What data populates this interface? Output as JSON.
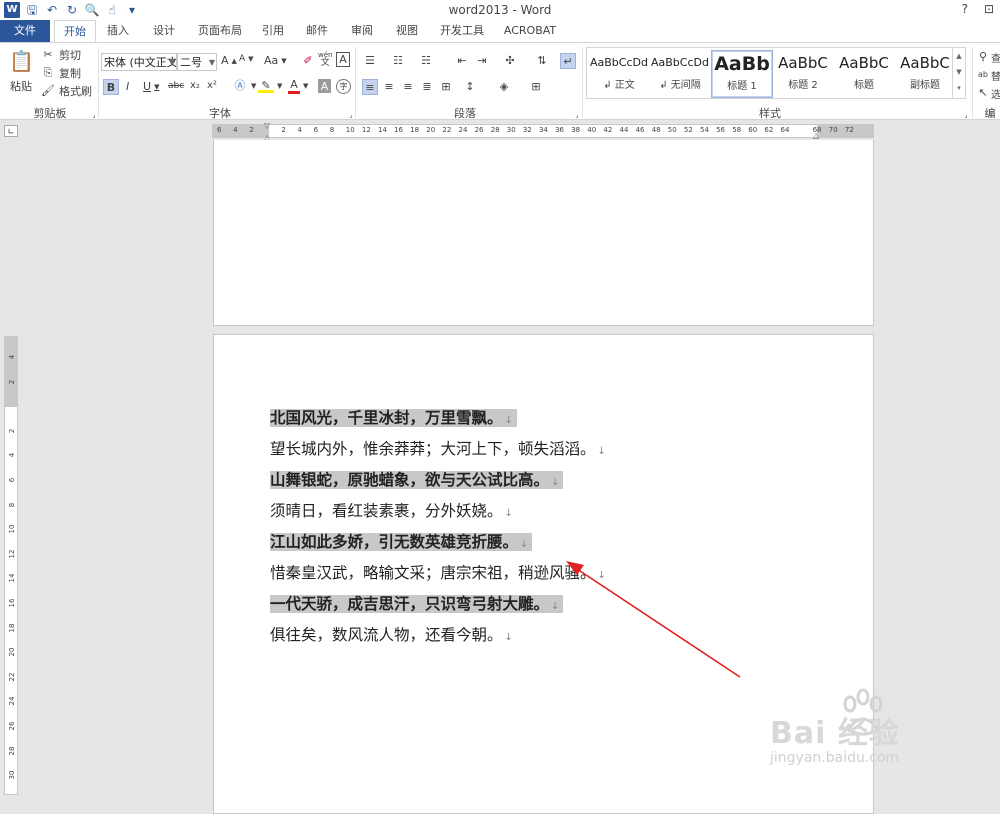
{
  "window": {
    "title": "word2013 - Word",
    "help": "?",
    "restore": "⊡"
  },
  "tabs": [
    "文件",
    "开始",
    "插入",
    "设计",
    "页面布局",
    "引用",
    "邮件",
    "审阅",
    "视图",
    "开发工具",
    "ACROBAT"
  ],
  "ribbon": {
    "clipboard": {
      "label": "剪贴板",
      "paste": "粘贴",
      "cut": "剪切",
      "copy": "复制",
      "format_painter": "格式刷"
    },
    "font": {
      "label": "字体",
      "font_name": "宋体 (中文正文",
      "font_size": "二号",
      "bold": "B",
      "italic": "I",
      "underline": "U",
      "strike": "abc",
      "sub": "x₂",
      "sup": "x²",
      "grow": "A",
      "shrink": "A",
      "case": "Aa",
      "font_color": "A",
      "char_shade": "A",
      "char_border": "A",
      "phonetic": "wén",
      "phonetic_sub": "文",
      "enclose": "字"
    },
    "paragraph": {
      "label": "段落"
    },
    "styles": {
      "label": "样式",
      "items": [
        {
          "sample": "AaBbCcDd",
          "name": "↲ 正文"
        },
        {
          "sample": "AaBbCcDd",
          "name": "↲ 无间隔"
        },
        {
          "sample": "AaBb",
          "name": "标题 1"
        },
        {
          "sample": "AaBbC",
          "name": "标题 2"
        },
        {
          "sample": "AaBbC",
          "name": "标题"
        },
        {
          "sample": "AaBbC",
          "name": "副标题"
        }
      ]
    },
    "editing": {
      "label": "编",
      "find": "查",
      "replace": "替",
      "select": "选"
    }
  },
  "ruler_h": [
    "6",
    "4",
    "2",
    "",
    "2",
    "4",
    "6",
    "8",
    "10",
    "12",
    "14",
    "16",
    "18",
    "20",
    "22",
    "24",
    "26",
    "28",
    "30",
    "32",
    "34",
    "36",
    "38",
    "40",
    "42",
    "44",
    "46",
    "48",
    "50",
    "52",
    "54",
    "56",
    "58",
    "60",
    "62",
    "64",
    "",
    "68",
    "70",
    "72"
  ],
  "ruler_v": [
    "4",
    "2",
    "",
    "2",
    "4",
    "6",
    "8",
    "10",
    "12",
    "14",
    "16",
    "18",
    "20",
    "22",
    "24",
    "26",
    "28",
    "30"
  ],
  "document": {
    "lines": [
      {
        "text": "北国风光，千里冰封，万里雪飘。",
        "highlight": true
      },
      {
        "text": "望长城内外，惟余莽莽；大河上下，顿失滔滔。",
        "highlight": false
      },
      {
        "text": "山舞银蛇，原驰蜡象，欲与天公试比高。",
        "highlight": true
      },
      {
        "text": "须晴日，看红装素裹，分外妖娆。",
        "highlight": false
      },
      {
        "text": "江山如此多娇，引无数英雄竞折腰。",
        "highlight": true
      },
      {
        "text": "惜秦皇汉武，略输文采；唐宗宋祖，稍逊风骚。",
        "highlight": false
      },
      {
        "text": "一代天骄，成吉思汗，只识弯弓射大雕。",
        "highlight": true
      },
      {
        "text": "俱往矣，数风流人物，还看今朝。",
        "highlight": false
      }
    ],
    "paragraph_mark": "↓"
  },
  "watermark": {
    "logo": "Bai  经验",
    "url": "jingyan.baidu.com"
  },
  "colors": {
    "accent": "#2b579a",
    "highlight": "#c8c8c8",
    "arrow": "#e02020"
  }
}
